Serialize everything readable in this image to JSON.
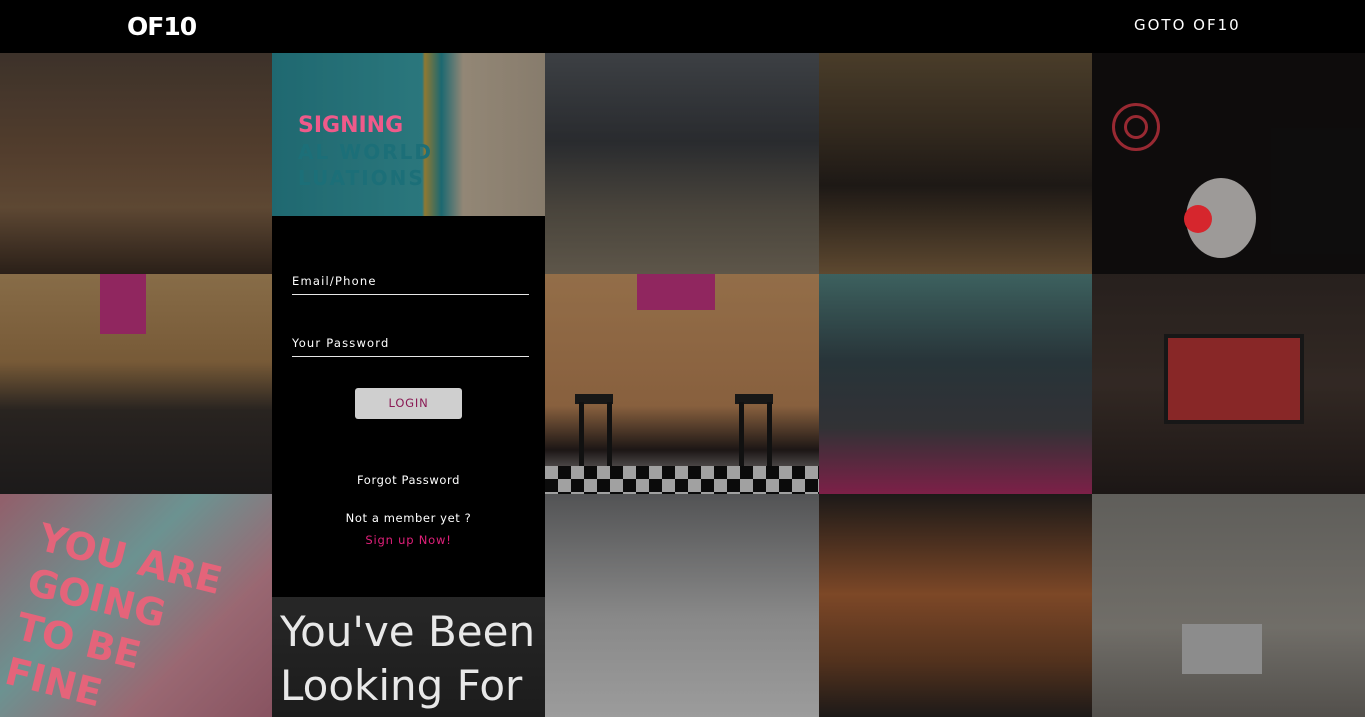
{
  "header": {
    "logo_text": "OF10",
    "goto_link": "GOTO OF10"
  },
  "login": {
    "email_label": "Email/Phone",
    "password_label": "Your Password",
    "login_button": "LOGIN",
    "forgot_password": "Forgot Password",
    "not_member": "Not a member yet ?",
    "signup": "Sign up Now!"
  },
  "tiles": {
    "poster_line1": "SIGNING",
    "poster_line2": "AL WORLD",
    "poster_line3": "LUATIONS",
    "neon_line1": "You've Been",
    "neon_line2": "Looking For",
    "art_line1": "YOU ARE",
    "art_line2": "GOING",
    "art_line3": "TO BE",
    "art_line4": "FINE"
  },
  "colors": {
    "accent_pink": "#e0207a",
    "button_bg": "#cfcfcf",
    "button_text": "#8a1a55"
  }
}
